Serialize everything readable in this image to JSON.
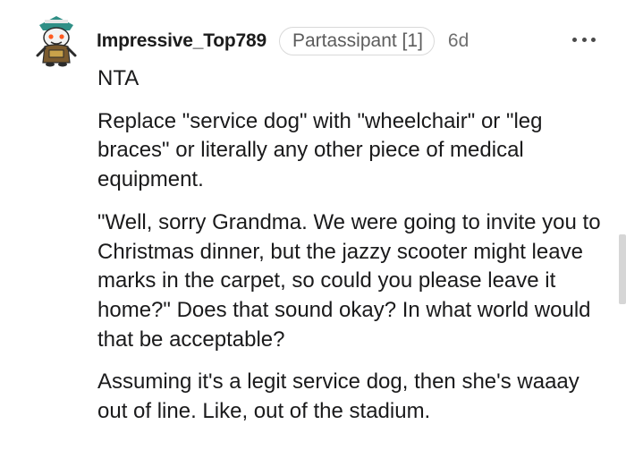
{
  "comment": {
    "author": "Impressive_Top789",
    "flair": "Partassipant [1]",
    "age": "6d",
    "more_icon": "more-horizontal-icon",
    "avatar_icon": "snoo-avatar-icon",
    "paragraphs": [
      "NTA",
      "Replace \"service dog\" with \"wheelchair\" or \"leg braces\" or literally any other piece of medical equipment.",
      "\"Well, sorry Grandma. We were going to invite you to Christmas dinner, but the jazzy scooter might leave marks in the carpet, so could you please leave it home?\" Does that sound okay? In what world would that be acceptable?",
      "Assuming it's a legit service dog, then she's waaay out of line. Like, out of the stadium."
    ]
  },
  "colors": {
    "text": "#1a1a1b",
    "meta": "#6e6e6e",
    "flair_border": "#d9d9d9",
    "avatar_teal": "#2f8f86",
    "avatar_brown": "#7a5a2e"
  }
}
